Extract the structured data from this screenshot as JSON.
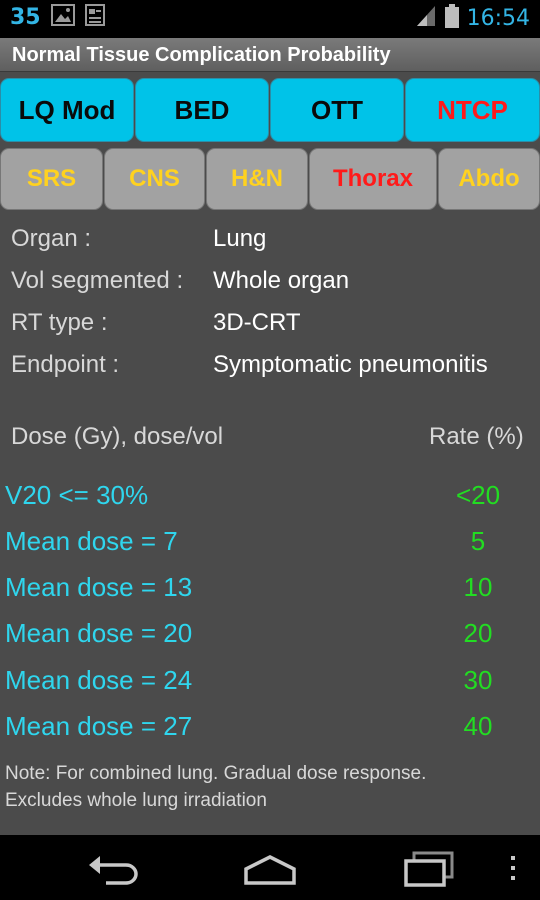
{
  "status_bar": {
    "notification_count": "35",
    "time": "16:54",
    "icons": [
      "image-icon",
      "news-icon",
      "signal-icon",
      "battery-icon"
    ]
  },
  "title": "Normal Tissue Complication Probability",
  "main_tabs": [
    {
      "label": "LQ Mod",
      "color": "#0a0a0a"
    },
    {
      "label": "BED",
      "color": "#0a0a0a"
    },
    {
      "label": "OTT",
      "color": "#0a0a0a"
    },
    {
      "label": "NTCP",
      "color": "#ff1a1a"
    }
  ],
  "sub_tabs": [
    {
      "label": "SRS",
      "color": "#ffd21f"
    },
    {
      "label": "CNS",
      "color": "#ffd21f"
    },
    {
      "label": "H&N",
      "color": "#ffd21f"
    },
    {
      "label": "Thorax",
      "color": "#ff1a1a"
    },
    {
      "label": "Abdo",
      "color": "#ffd21f"
    }
  ],
  "info": {
    "organ_label": "Organ :",
    "organ_value": "Lung",
    "vol_label": "Vol segmented :",
    "vol_value": "Whole organ",
    "rt_label": "RT type :",
    "rt_value": "3D-CRT",
    "endpoint_label": "Endpoint :",
    "endpoint_value": "Symptomatic pneumonitis"
  },
  "table": {
    "dose_header": "Dose (Gy), dose/vol",
    "rate_header": "Rate (%)",
    "rows": [
      {
        "dose": "V20 <= 30%",
        "rate": "<20"
      },
      {
        "dose": "Mean dose = 7",
        "rate": "5"
      },
      {
        "dose": "Mean dose = 13",
        "rate": "10"
      },
      {
        "dose": "Mean dose = 20",
        "rate": "20"
      },
      {
        "dose": "Mean dose = 24",
        "rate": "30"
      },
      {
        "dose": "Mean dose = 27",
        "rate": "40"
      }
    ]
  },
  "note": {
    "line1": "Note: For combined lung. Gradual dose response.",
    "line2": "Excludes whole lung irradiation"
  },
  "nav_bar": {
    "icons": [
      "back-icon",
      "home-icon",
      "recent-apps-icon",
      "overflow-menu-icon"
    ]
  }
}
